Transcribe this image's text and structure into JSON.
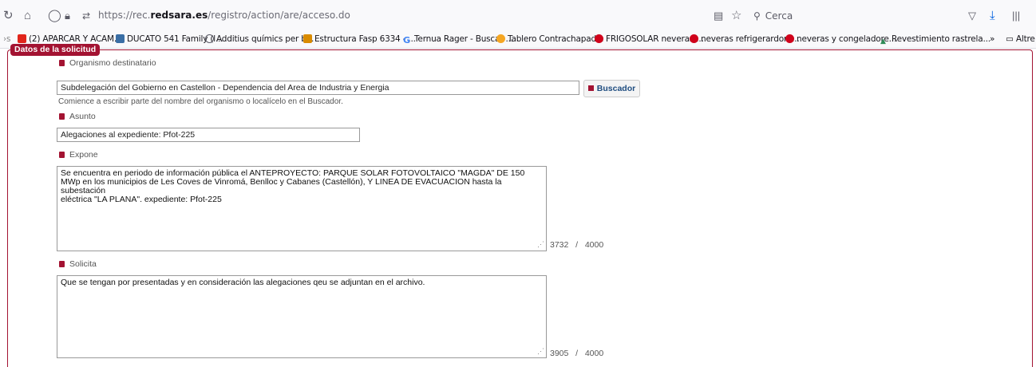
{
  "browser": {
    "url_prefix": "https://rec.",
    "url_domain": "redsara.es",
    "url_path": "/registro/action/are/acceso.do",
    "search_placeholder": "Cerca",
    "bookmarks": [
      {
        "label": "(2) APARCAR Y ACAM...",
        "color": "#e1251b"
      },
      {
        "label": "DUCATO 541 Family (l...",
        "color": "#3a6ea5"
      },
      {
        "label": "Additius químics per b...",
        "color": "#5b5b66"
      },
      {
        "label": "Estructura Fasp 6334 - ...",
        "color": "#d98b00"
      },
      {
        "label": "Ternua Rager - Buscar ...",
        "color": "#4285f4"
      },
      {
        "label": "Tablero Contrachapad...",
        "color": "#f5a623"
      },
      {
        "label": "FRIGOSOLAR neveras ...",
        "color": "#d0021b"
      },
      {
        "label": "neveras refrigerardore...",
        "color": "#d0021b"
      },
      {
        "label": "neveras y congeladore...",
        "color": "#d0021b"
      },
      {
        "label": "Revestimiento rastrela...",
        "color": "#2e8b57"
      }
    ],
    "other_bookmarks": "Altre"
  },
  "form": {
    "legend": "Datos de la solicitud",
    "organismo": {
      "label": "Organismo destinatario",
      "value": "Subdelegación del Gobierno en Castellon - Dependencia del Area de Industria y Energia",
      "button": "Buscador",
      "hint": "Comience a escribir parte del nombre del organismo o localícelo en el Buscador."
    },
    "asunto": {
      "label": "Asunto",
      "value": "Alegaciones al expediente: Pfot-225"
    },
    "expone": {
      "label": "Expone",
      "value": "Se encuentra en periodo de información pública el ANTEPROYECTO: PARQUE SOLAR FOTOVOLTAICO \"MAGDA\" DE 150\nMWp en los municipios de Les Coves de Vinromá, Benlloc y Cabanes (Castellón), Y LINEA DE EVACUACION hasta la subestación\neléctrica \"LA PLANA\". expediente: Pfot-225",
      "count": "3732",
      "sep": "/",
      "max": "4000"
    },
    "solicita": {
      "label": "Solicita",
      "value": "Que se tengan por presentadas y en consideración las alegaciones qeu se adjuntan en el archivo.",
      "count": "3905",
      "sep": "/",
      "max": "4000"
    }
  }
}
